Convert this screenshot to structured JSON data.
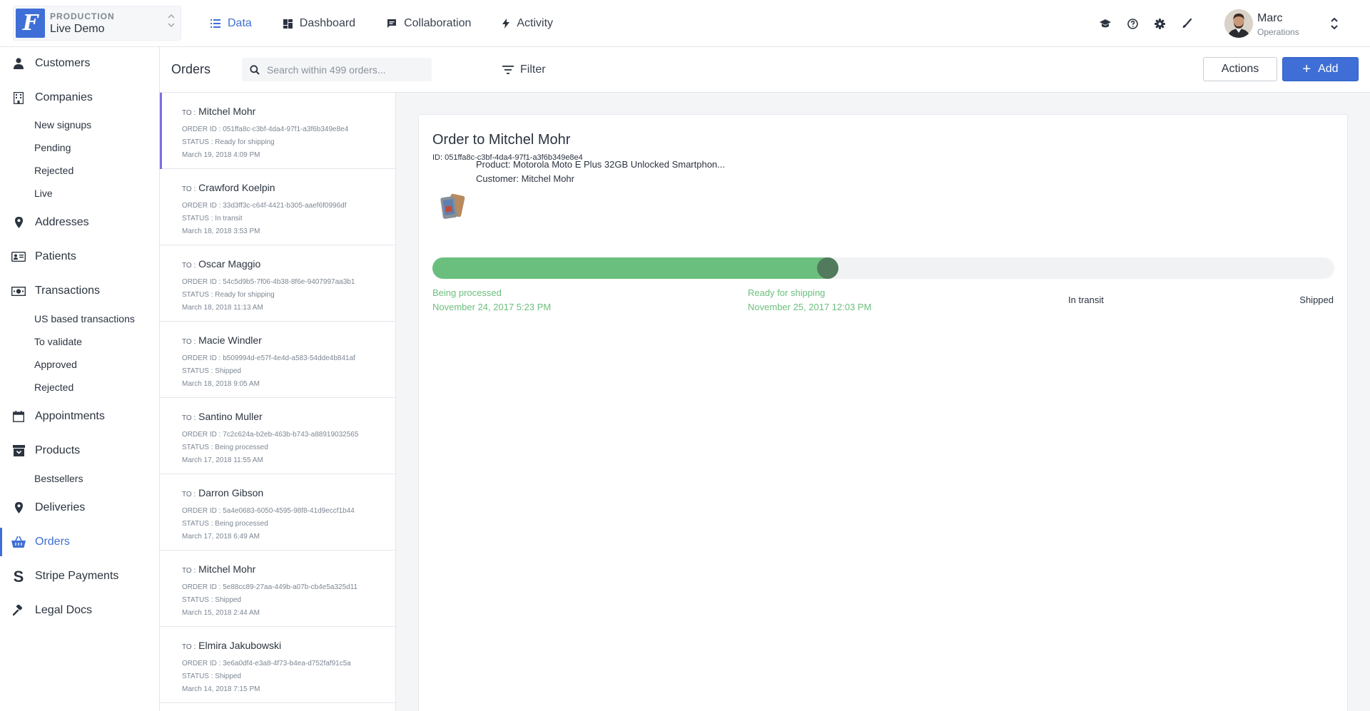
{
  "project": {
    "environment": "PRODUCTION",
    "name": "Live Demo",
    "logo_letter": "F"
  },
  "nav": [
    {
      "label": "Data",
      "icon": "list-icon",
      "active": true
    },
    {
      "label": "Dashboard",
      "icon": "dashboard-icon",
      "active": false
    },
    {
      "label": "Collaboration",
      "icon": "chat-icon",
      "active": false
    },
    {
      "label": "Activity",
      "icon": "bolt-icon",
      "active": false
    }
  ],
  "tools": [
    "graduation-cap-icon",
    "help-icon",
    "gear-icon",
    "brush-icon"
  ],
  "user": {
    "name": "Marc",
    "role": "Operations"
  },
  "sidebar": {
    "customers": "Customers",
    "companies": "Companies",
    "companies_sub": [
      "New signups",
      "Pending",
      "Rejected",
      "Live"
    ],
    "addresses": "Addresses",
    "patients": "Patients",
    "transactions": "Transactions",
    "transactions_sub": [
      "US based transactions",
      "To validate",
      "Approved",
      "Rejected"
    ],
    "appointments": "Appointments",
    "products": "Products",
    "products_sub": [
      "Bestsellers"
    ],
    "deliveries": "Deliveries",
    "orders": "Orders",
    "stripe": "Stripe Payments",
    "legal": "Legal Docs"
  },
  "list_header": {
    "title": "Orders",
    "search_placeholder": "Search within 499 orders...",
    "filter": "Filter",
    "actions": "Actions",
    "add": "Add"
  },
  "orders": [
    {
      "to_key": "TO :",
      "to": "Mitchel Mohr",
      "order_id": "ORDER ID : 051ffa8c-c3bf-4da4-97f1-a3f6b349e8e4",
      "status": "STATUS : Ready for shipping",
      "date": "March 19, 2018 4:09 PM"
    },
    {
      "to_key": "TO :",
      "to": "Crawford Koelpin",
      "order_id": "ORDER ID : 33d3ff3c-c64f-4421-b305-aaef6f0996df",
      "status": "STATUS : In transit",
      "date": "March 18, 2018 3:53 PM"
    },
    {
      "to_key": "TO :",
      "to": "Oscar Maggio",
      "order_id": "ORDER ID : 54c5d9b5-7f06-4b38-8f6e-9407997aa3b1",
      "status": "STATUS : Ready for shipping",
      "date": "March 18, 2018 11:13 AM"
    },
    {
      "to_key": "TO :",
      "to": "Macie Windler",
      "order_id": "ORDER ID : b509994d-e57f-4e4d-a583-54dde4b841af",
      "status": "STATUS : Shipped",
      "date": "March 18, 2018 9:05 AM"
    },
    {
      "to_key": "TO :",
      "to": "Santino Muller",
      "order_id": "ORDER ID : 7c2c624a-b2eb-463b-b743-a88919032565",
      "status": "STATUS : Being processed",
      "date": "March 17, 2018 11:55 AM"
    },
    {
      "to_key": "TO :",
      "to": "Darron Gibson",
      "order_id": "ORDER ID : 5a4e0683-6050-4595-98f8-41d9eccf1b44",
      "status": "STATUS : Being processed",
      "date": "March 17, 2018 6:49 AM"
    },
    {
      "to_key": "TO :",
      "to": "Mitchel Mohr",
      "order_id": "ORDER ID : 5e88cc89-27aa-449b-a07b-cb4e5a325d11",
      "status": "STATUS : Shipped",
      "date": "March 15, 2018 2:44 AM"
    },
    {
      "to_key": "TO :",
      "to": "Elmira Jakubowski",
      "order_id": "ORDER ID : 3e6a0df4-e3a8-4f73-b4ea-d752faf91c5a",
      "status": "STATUS : Shipped",
      "date": "March 14, 2018 7:15 PM"
    }
  ],
  "detail": {
    "title": "Order to Mitchel Mohr",
    "id": "ID: 051ffa8c-c3bf-4da4-97f1-a3f6b349e8e4",
    "product": "Product: Motorola Moto E Plus 32GB Unlocked Smartphon...",
    "customer": "Customer: Mitchel Mohr",
    "progress": 0.45,
    "steps": [
      {
        "label": "Being processed",
        "date": "November 24, 2017 5:23 PM",
        "done": true
      },
      {
        "label": "Ready for shipping",
        "date": "November 25, 2017 12:03 PM",
        "done": true
      },
      {
        "label": "In transit",
        "date": "",
        "done": false
      },
      {
        "label": "Shipped",
        "date": "",
        "done": false
      }
    ]
  },
  "colors": {
    "accent": "#3f6fd6",
    "success": "#6bbf7e",
    "selected_bar": "#7c6fe0"
  }
}
